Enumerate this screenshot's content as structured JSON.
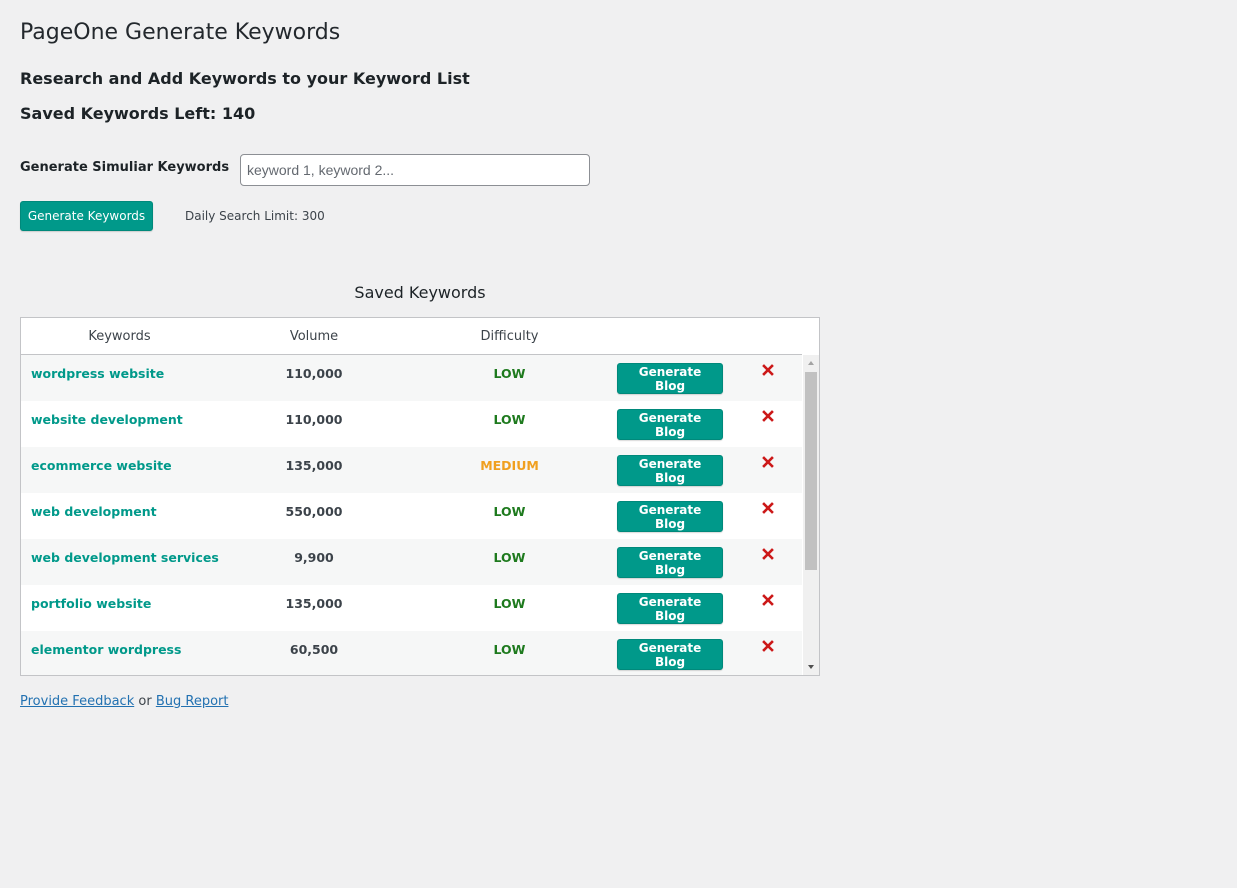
{
  "page": {
    "title": "PageOne Generate Keywords",
    "subtitle": "Research and Add Keywords to your Keyword List",
    "saved_keywords_left": "Saved Keywords Left: 140"
  },
  "generator": {
    "label": "Generate Simuliar Keywords",
    "input_value": "",
    "input_placeholder": "keyword 1, keyword 2...",
    "button_label": "Generate Keywords",
    "daily_limit": "Daily Search Limit: 300"
  },
  "saved": {
    "heading": "Saved Keywords",
    "columns": [
      "Keywords",
      "Volume",
      "Difficulty"
    ],
    "generate_blog_label": "Generate Blog",
    "rows": [
      {
        "keyword": "wordpress website",
        "volume": "110,000",
        "difficulty": "LOW"
      },
      {
        "keyword": "website development",
        "volume": "110,000",
        "difficulty": "LOW"
      },
      {
        "keyword": "ecommerce website",
        "volume": "135,000",
        "difficulty": "MEDIUM"
      },
      {
        "keyword": "web development",
        "volume": "550,000",
        "difficulty": "LOW"
      },
      {
        "keyword": "web development services",
        "volume": "9,900",
        "difficulty": "LOW"
      },
      {
        "keyword": "portfolio website",
        "volume": "135,000",
        "difficulty": "LOW"
      },
      {
        "keyword": "elementor wordpress",
        "volume": "60,500",
        "difficulty": "LOW"
      }
    ]
  },
  "footer": {
    "feedback_link": "Provide Feedback",
    "separator": "or",
    "bug_link": "Bug Report"
  },
  "colors": {
    "accent": "#00998a",
    "low": "#1e7a1e",
    "medium": "#f0a020",
    "delete": "#cc1818",
    "link": "#2271b1"
  },
  "icons": {
    "delete": "close-icon",
    "scroll_up": "chevron-up-icon",
    "scroll_down": "chevron-down-icon"
  }
}
